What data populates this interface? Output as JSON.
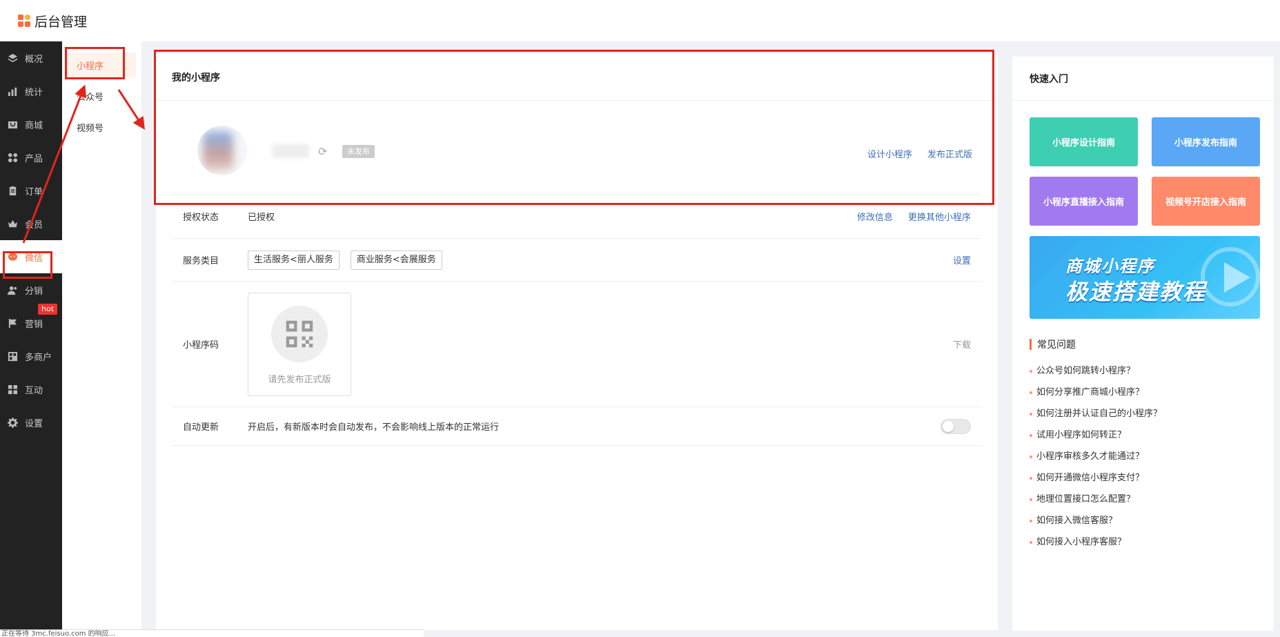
{
  "header": {
    "app_title": "后台管理"
  },
  "sidebar": {
    "items": [
      {
        "label": "概况",
        "icon": "layers-icon"
      },
      {
        "label": "统计",
        "icon": "chart-icon"
      },
      {
        "label": "商城",
        "icon": "shop-icon"
      },
      {
        "label": "产品",
        "icon": "grid-icon"
      },
      {
        "label": "订单",
        "icon": "clipboard-icon"
      },
      {
        "label": "会员",
        "icon": "crown-icon"
      },
      {
        "label": "微信",
        "icon": "wechat-icon",
        "active": true
      },
      {
        "label": "分销",
        "icon": "users-icon"
      },
      {
        "label": "营销",
        "icon": "flag-icon",
        "badge": "hot"
      },
      {
        "label": "多商户",
        "icon": "store-icon"
      },
      {
        "label": "互动",
        "icon": "apps-icon"
      },
      {
        "label": "设置",
        "icon": "gear-icon"
      }
    ]
  },
  "subnav": {
    "items": [
      {
        "label": "小程序",
        "active": true
      },
      {
        "label": "公众号"
      },
      {
        "label": "视频号"
      }
    ]
  },
  "main": {
    "title": "我的小程序",
    "status_tag": "未发布",
    "actions": {
      "design": "设计小程序",
      "publish": "发布正式版"
    },
    "auth": {
      "label": "授权状态",
      "value": "已授权",
      "edit": "修改信息",
      "switch": "更换其他小程序"
    },
    "category": {
      "label": "服务类目",
      "tags": [
        "生活服务<丽人服务",
        "商业服务<会展服务"
      ],
      "set": "设置"
    },
    "qrcode": {
      "label": "小程序码",
      "hint": "请先发布正式版",
      "download": "下载"
    },
    "auto_update": {
      "label": "自动更新",
      "desc": "开启后，有新版本时会自动发布，不会影响线上版本的正常运行",
      "enabled": false
    }
  },
  "quick": {
    "title": "快速入门",
    "tiles": [
      {
        "label": "小程序设计指南",
        "color": "#3ecfb3"
      },
      {
        "label": "小程序发布指南",
        "color": "#5aa7f5"
      },
      {
        "label": "小程序直播接入指南",
        "color": "#a27af0"
      },
      {
        "label": "视频号开店接入指南",
        "color": "#ff8a6a"
      }
    ],
    "banner": {
      "line1": "商城小程序",
      "line2": "极速搭建教程"
    },
    "faq_title": "常见问题",
    "faq": [
      "公众号如何跳转小程序？",
      "如何分享推广商城小程序？",
      "如何注册并认证自己的小程序？",
      "试用小程序如何转正？",
      "小程序审核多久才能通过？",
      "如何开通微信小程序支付？",
      "地理位置接口怎么配置？",
      "如何接入微信客服？",
      "如何接入小程序客服？"
    ]
  },
  "statusbar": {
    "text": "正在等待 3mc.feisuo.com 的响应..."
  },
  "colors": {
    "accent": "#ff6a3d",
    "annotation": "#e1251b",
    "link": "#3d6fb8"
  }
}
